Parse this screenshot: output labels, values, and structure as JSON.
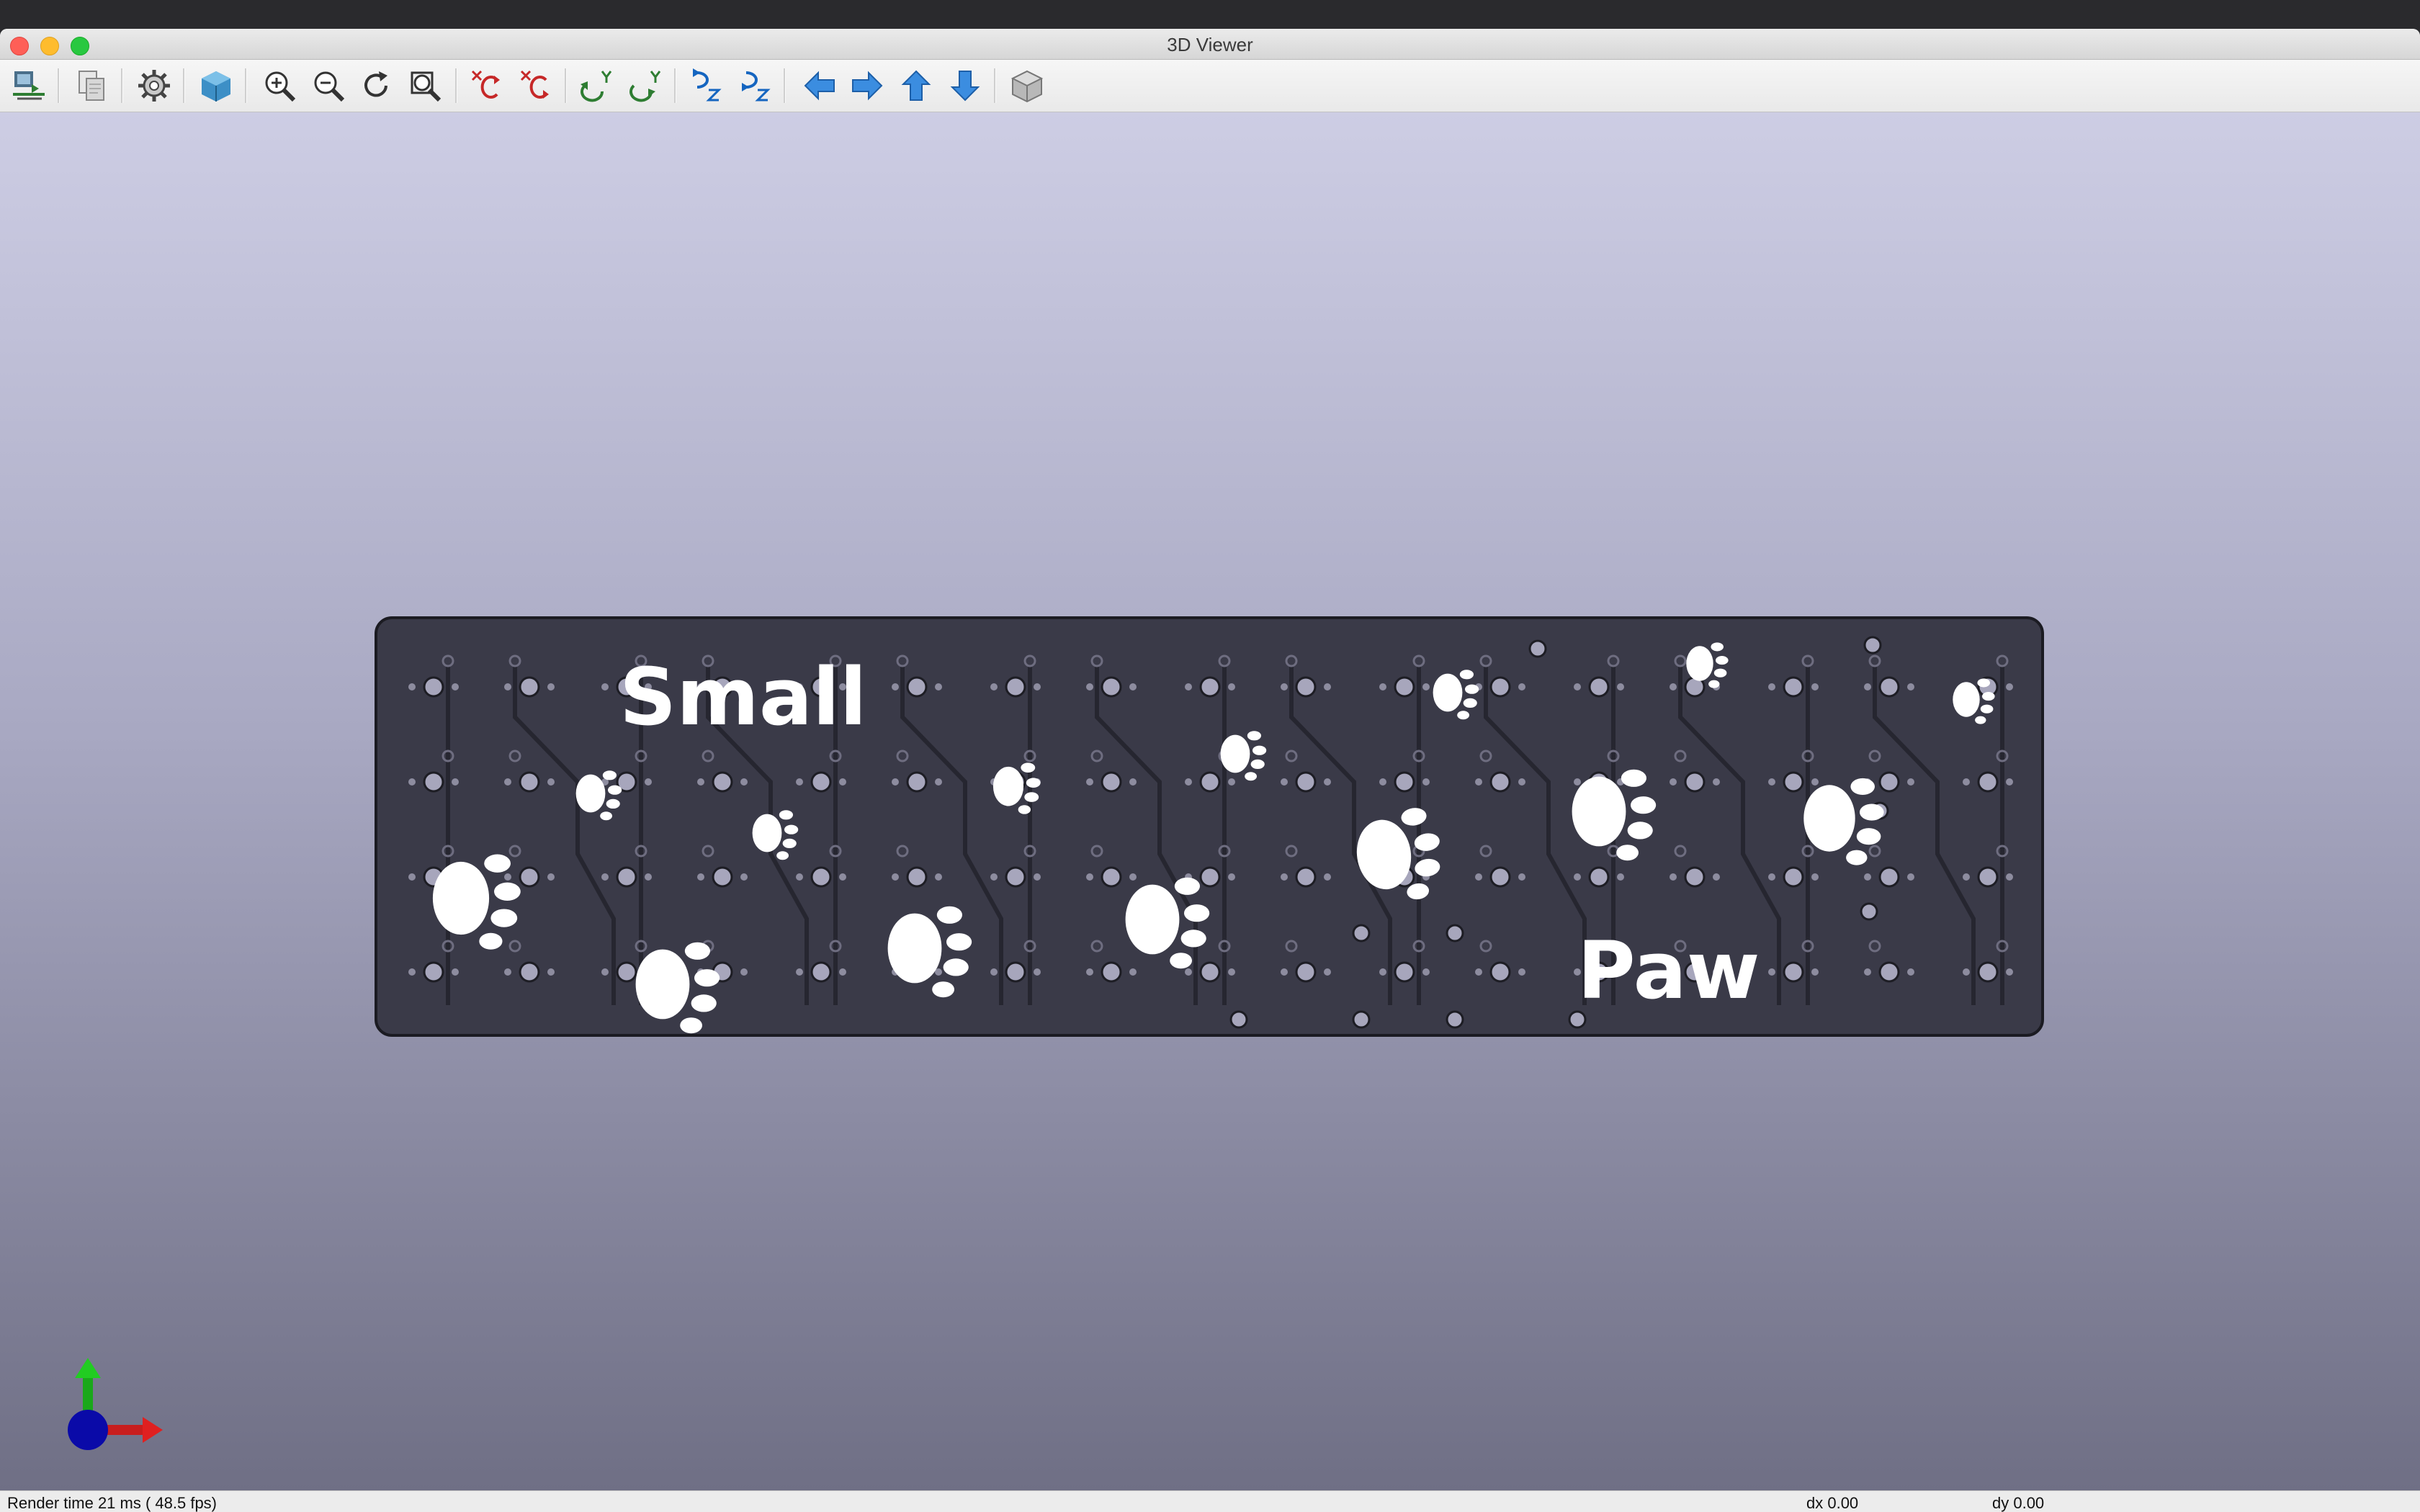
{
  "window": {
    "title": "3D Viewer"
  },
  "toolbar": {
    "buttons": [
      {
        "name": "reload-board-icon",
        "tooltip": "Reload board"
      },
      {
        "name": "copy-image-icon",
        "tooltip": "Copy 3D image to clipboard"
      },
      {
        "name": "settings-gear-icon",
        "tooltip": "3D display options"
      },
      {
        "name": "raytrace-cube-icon",
        "tooltip": "Render current view using raytracing"
      },
      {
        "name": "zoom-in-icon",
        "tooltip": "Zoom in"
      },
      {
        "name": "zoom-out-icon",
        "tooltip": "Zoom out"
      },
      {
        "name": "redraw-icon",
        "tooltip": "Redraw view"
      },
      {
        "name": "zoom-fit-icon",
        "tooltip": "Zoom to fit"
      },
      {
        "name": "rotate-x-cw-icon",
        "tooltip": "Rotate X clockwise"
      },
      {
        "name": "rotate-x-ccw-icon",
        "tooltip": "Rotate X counterclockwise"
      },
      {
        "name": "rotate-y-cw-icon",
        "tooltip": "Rotate Y clockwise"
      },
      {
        "name": "rotate-y-ccw-icon",
        "tooltip": "Rotate Y counterclockwise"
      },
      {
        "name": "rotate-z-cw-icon",
        "tooltip": "Rotate Z clockwise"
      },
      {
        "name": "rotate-z-ccw-icon",
        "tooltip": "Rotate Z counterclockwise"
      },
      {
        "name": "pan-left-icon",
        "tooltip": "Pan left"
      },
      {
        "name": "pan-right-icon",
        "tooltip": "Pan right"
      },
      {
        "name": "pan-up-icon",
        "tooltip": "Pan up"
      },
      {
        "name": "pan-down-icon",
        "tooltip": "Pan down"
      },
      {
        "name": "ortho-toggle-icon",
        "tooltip": "Enable/disable orthographic projection"
      }
    ]
  },
  "board": {
    "silk_text_top": "Small",
    "silk_text_bottom": "Paw"
  },
  "status": {
    "render_time": "Render time 21 ms ( 48.5 fps)",
    "dx": "dx 0.00",
    "dy": "dy 0.00"
  },
  "colors": {
    "board": "#3a3a48",
    "silkscreen": "#ffffff",
    "pad": "#a7a6bc",
    "viewport_top": "#cdcde4",
    "viewport_bottom": "#6f6f85"
  }
}
